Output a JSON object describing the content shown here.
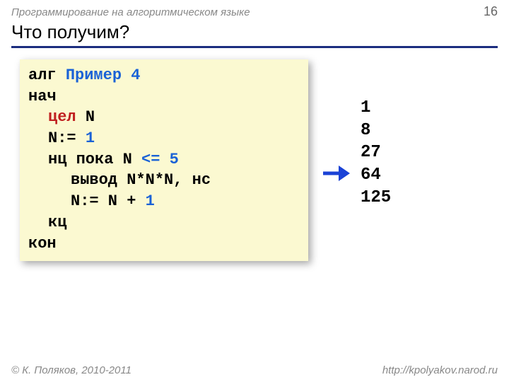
{
  "header": {
    "subject": "Программирование на алгоритмическом языке",
    "page": "16"
  },
  "title": "Что получим?",
  "code": {
    "l1_kw": "алг ",
    "l1_name": "Пример 4",
    "l2": "нач",
    "l3_kw": "цел ",
    "l3_var": "N",
    "l4_lhs": "N:= ",
    "l4_rhs": "1",
    "l5_a": "нц пока N ",
    "l5_op": "<= ",
    "l5_b": "5",
    "l6": "вывод N*N*N, нс",
    "l7_lhs": "N:= N",
    "l7_mid": " + ",
    "l7_rhs": "1",
    "l8": "кц",
    "l9": "кон"
  },
  "output": {
    "o1": "1",
    "o2": "8",
    "o3": "27",
    "o4": "64",
    "o5": "125"
  },
  "footer": {
    "left": "© К. Поляков, 2010-2011",
    "right": "http://kpolyakov.narod.ru"
  }
}
